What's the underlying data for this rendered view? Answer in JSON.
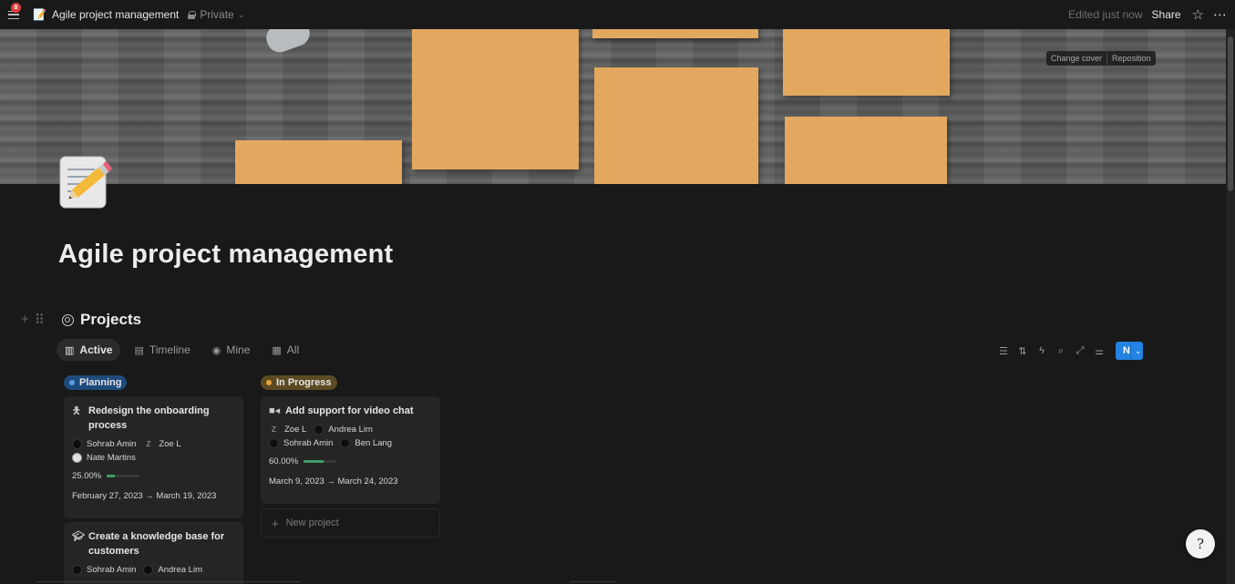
{
  "topbar": {
    "notification_count": "8",
    "page_emoji": "📝",
    "page_title": "Agile project management",
    "privacy": "Private",
    "edited": "Edited just now",
    "share": "Share"
  },
  "cover": {
    "change_cover": "Change cover",
    "reposition": "Reposition"
  },
  "page": {
    "title": "Agile project management"
  },
  "database": {
    "title": "Projects",
    "views": [
      {
        "label": "Active",
        "icon": "board-icon"
      },
      {
        "label": "Timeline",
        "icon": "timeline-icon"
      },
      {
        "label": "Mine",
        "icon": "person-icon"
      },
      {
        "label": "All",
        "icon": "grid-icon"
      }
    ],
    "new_label": "New",
    "new_project_label": "New project"
  },
  "columns": [
    {
      "label": "Planning",
      "color": "#2e6bb5",
      "dot": "#5b9ce6",
      "cards": [
        {
          "icon": "person-running-icon",
          "title": "Redesign the onboarding process",
          "people": [
            "Sohrab Amin",
            "Zoe L",
            "Nate Martins"
          ],
          "progress_label": "25.00%",
          "progress": 0.25,
          "dates": "February 27, 2023 → March 19, 2023"
        },
        {
          "icon": "graduation-cap-icon",
          "title": "Create a knowledge base for customers",
          "people": [
            "Sohrab Amin",
            "Andrea Lim"
          ]
        }
      ]
    },
    {
      "label": "In Progress",
      "color": "#5f4a23",
      "dot": "#e3a33a",
      "cards": [
        {
          "icon": "video-camera-icon",
          "title": "Add support for video chat",
          "people": [
            "Zoe L",
            "Andrea Lim",
            "Sohrab Amin",
            "Ben Lang"
          ],
          "progress_label": "60.00%",
          "progress": 0.6,
          "dates": "March 9, 2023 → March 24, 2023"
        }
      ]
    }
  ]
}
